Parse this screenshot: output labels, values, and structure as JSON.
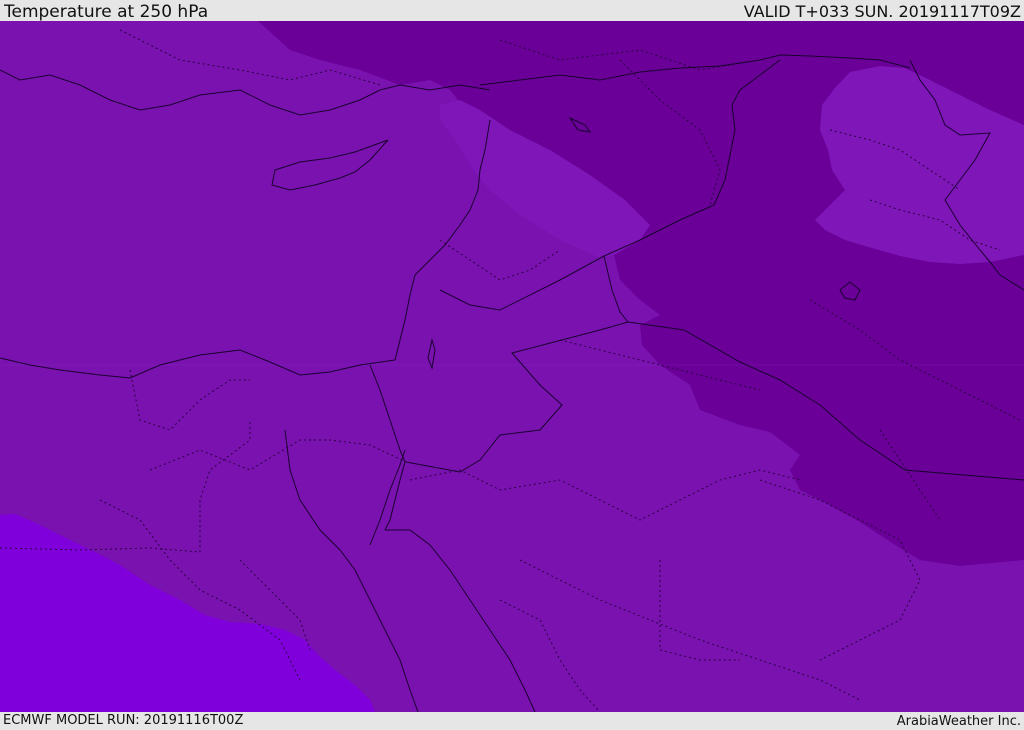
{
  "header": {
    "title": "Temperature at 250 hPa",
    "valid": "VALID T+033 SUN. 20191117T09Z"
  },
  "footer": {
    "model_run": "ECMWF MODEL RUN: 20191116T00Z",
    "credit": "ArabiaWeather Inc."
  },
  "map": {
    "region": "Eastern Mediterranean and Middle East",
    "temperature_fill_colors": {
      "base_band": "#7a12b0",
      "cold_band": "#6a0098",
      "lighter_band": "#7e16b8",
      "warm_band": "#8000dc"
    }
  }
}
